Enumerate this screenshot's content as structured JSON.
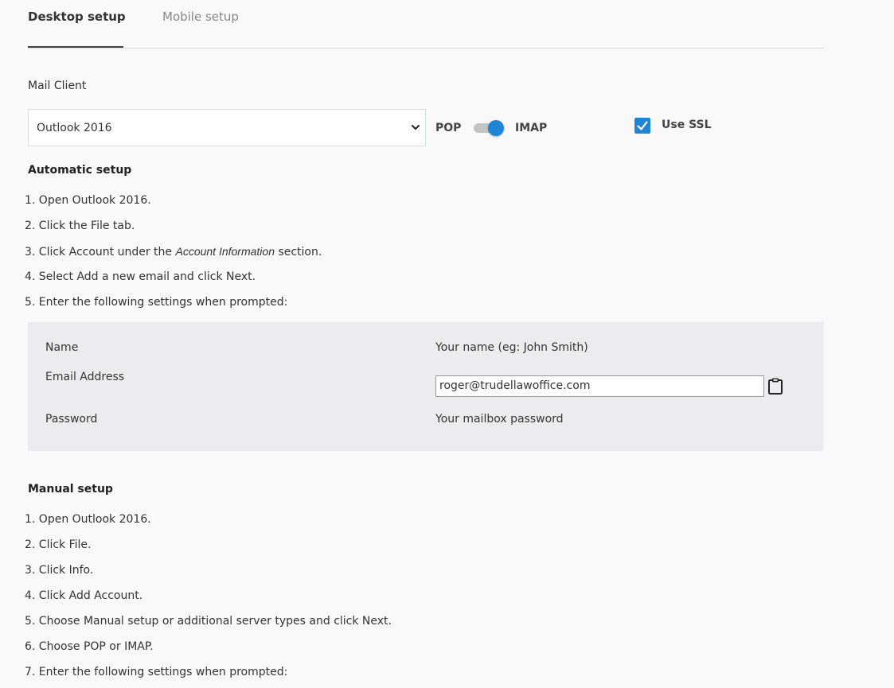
{
  "tabs": {
    "desktop": "Desktop setup",
    "mobile": "Mobile setup"
  },
  "mail_client": {
    "label": "Mail Client",
    "selected": "Outlook 2016"
  },
  "protocol": {
    "pop_label": "POP",
    "imap_label": "IMAP",
    "selected": "IMAP"
  },
  "ssl": {
    "label": "Use SSL",
    "checked": true
  },
  "automatic": {
    "heading": "Automatic setup",
    "steps": {
      "s1": "1. Open Outlook 2016.",
      "s2": "2. Click the File tab.",
      "s3_pre": "3. Click Account under the ",
      "s3_em": "Account Information",
      "s3_post": " section.",
      "s4": "4. Select Add a new email and click Next.",
      "s5": "5. Enter the following settings when prompted:"
    }
  },
  "settings": {
    "name_label": "Name",
    "name_value": "Your name (eg: John Smith)",
    "email_label": "Email Address",
    "email_value": "roger@trudellawoffice.com",
    "password_label": "Password",
    "password_value": "Your mailbox password"
  },
  "manual": {
    "heading": "Manual setup",
    "steps": {
      "s1": "1. Open Outlook 2016.",
      "s2": "2. Click File.",
      "s3": "3. Click Info.",
      "s4": "4. Click Add Account.",
      "s5": "5. Choose Manual setup or additional server types and click Next.",
      "s6": "6. Choose POP or IMAP.",
      "s7": "7. Enter the following settings when prompted:"
    }
  },
  "colors": {
    "accent": "#1f86d6",
    "panel": "#ececee",
    "background": "#f9f9f9"
  },
  "icons": {
    "chevron": "chevron-down-icon",
    "check": "check-icon",
    "clipboard": "clipboard-icon"
  }
}
